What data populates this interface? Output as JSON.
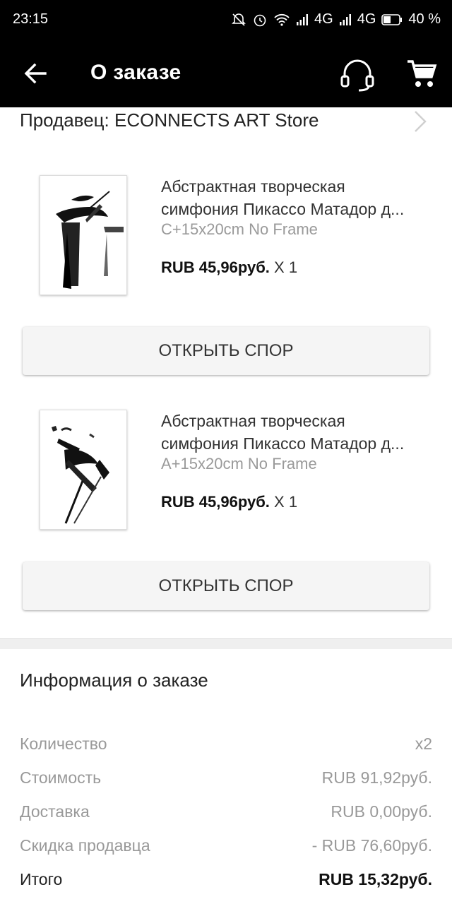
{
  "statusbar": {
    "time": "23:15",
    "network1": "4G",
    "network2": "4G",
    "battery": "40 %"
  },
  "appbar": {
    "title": "О заказе"
  },
  "seller": {
    "label": "Продавец: ECONNECTS ART Store"
  },
  "items": [
    {
      "name_line1": "Абстрактная творческая",
      "name_line2": "симфония Пикассо Матадор д...",
      "sku": "C+15x20cm No Frame",
      "price": "RUB 45,96руб.",
      "qty": "X 1",
      "button": "ОТКРЫТЬ СПОР"
    },
    {
      "name_line1": "Абстрактная творческая",
      "name_line2": "симфония Пикассо Матадор д...",
      "sku": "A+15x20cm No Frame",
      "price": "RUB 45,96руб.",
      "qty": "X 1",
      "button": "ОТКРЫТЬ СПОР"
    }
  ],
  "order_info": {
    "title": "Информация о заказе",
    "rows": [
      {
        "label": "Количество",
        "value": "x2"
      },
      {
        "label": "Стоимость",
        "value": "RUB 91,92руб."
      },
      {
        "label": "Доставка",
        "value": "RUB 0,00руб."
      },
      {
        "label": "Скидка продавца",
        "value": "- RUB 76,60руб."
      },
      {
        "label": "Итого",
        "value": "RUB 15,32руб."
      }
    ]
  },
  "icons": {
    "back": "arrow-back-icon",
    "support": "headset-icon",
    "cart": "cart-icon",
    "chevron": "chevron-right-icon"
  }
}
